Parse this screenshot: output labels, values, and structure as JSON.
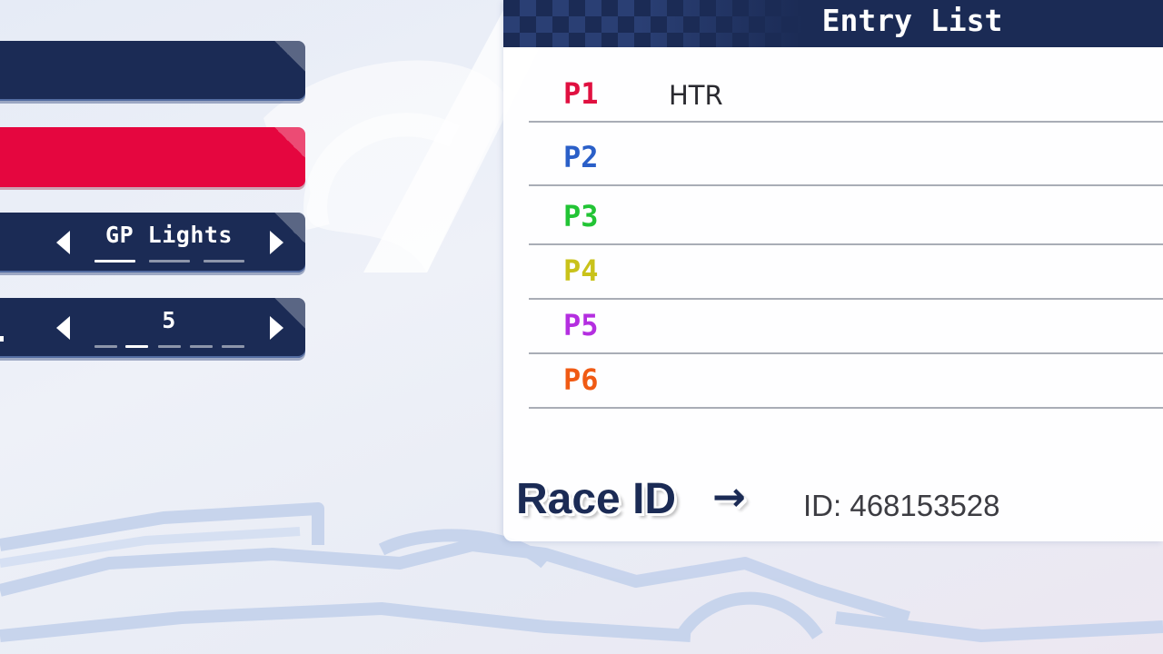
{
  "menu": {
    "series_selector": {
      "value": "GP Lights",
      "options_count": 3,
      "selected_index": 0
    },
    "count_selector": {
      "value": "5",
      "options_count": 5,
      "selected_index": 1
    }
  },
  "entry_list": {
    "title": "Entry List",
    "entries": [
      {
        "position": "P1",
        "driver": "HTR",
        "color": "#e01040"
      },
      {
        "position": "P2",
        "driver": "",
        "color": "#2a5fc8"
      },
      {
        "position": "P3",
        "driver": "",
        "color": "#22c435"
      },
      {
        "position": "P4",
        "driver": "",
        "color": "#c9c21a"
      },
      {
        "position": "P5",
        "driver": "",
        "color": "#b42ee0"
      },
      {
        "position": "P6",
        "driver": "",
        "color": "#f05a14"
      }
    ]
  },
  "race_id": {
    "label": "Race ID",
    "arrow": "→",
    "value": "ID: 468153528"
  },
  "colors": {
    "navy": "#1b2b55",
    "accent_red": "#e5063f"
  }
}
